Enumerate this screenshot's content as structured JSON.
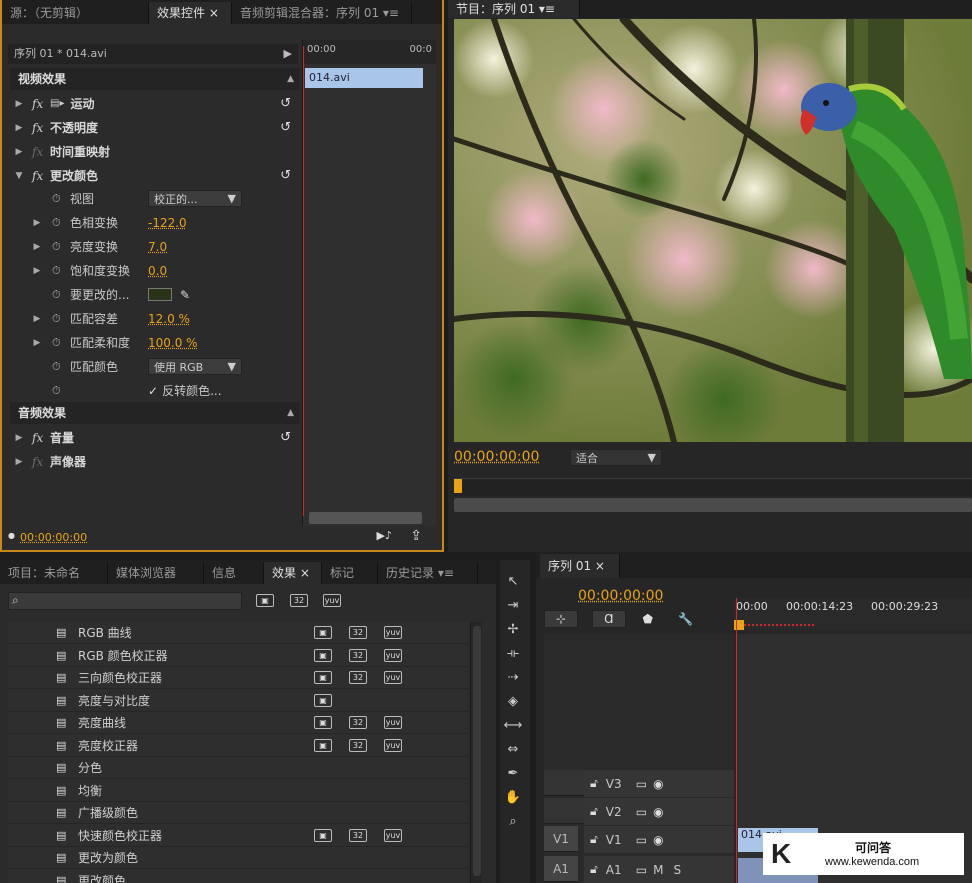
{
  "colors": {
    "accent": "#e8a317",
    "playhead": "#c62d2d",
    "clip": "#a9c6e8"
  },
  "effect_controls": {
    "tabs": [
      "源：（无剪辑）",
      "效果控件",
      "音频剪辑混合器：序列 01"
    ],
    "tab_close": "×",
    "header": "序列 01 * 014.avi",
    "time_ruler": [
      "00:00",
      "00:0"
    ],
    "clip_label": "014.avi",
    "video_section": "视频效果",
    "audio_section": "音频效果",
    "motion": "运动",
    "opacity": "不透明度",
    "time_remap": "时间重映射",
    "change_color": "更改颜色",
    "params": {
      "view_label": "视图",
      "view_value": "校正的...",
      "hue_label": "色相变换",
      "hue_value": "-122.0",
      "light_label": "亮度变换",
      "light_value": "7.0",
      "sat_label": "饱和度变换",
      "sat_value": "0.0",
      "color_label": "要更改的...",
      "tol_label": "匹配容差",
      "tol_value": "12.0 %",
      "soft_label": "匹配柔和度",
      "soft_value": "100.0 %",
      "match_label": "匹配颜色",
      "match_value": "使用 RGB",
      "invert_label": "反转颜色..."
    },
    "volume": "音量",
    "panner": "声像器",
    "timecode": "00:00:00:00"
  },
  "program": {
    "tab": "节目：序列 01",
    "timecode": "00:00:00:00",
    "fit": "适合"
  },
  "effects": {
    "tabs": [
      "项目：未命名",
      "媒体浏览器",
      "信息",
      "效果",
      "标记",
      "历史记录"
    ],
    "items": [
      "RGB 曲线",
      "RGB 颜色校正器",
      "三向颜色校正器",
      "亮度与对比度",
      "亮度曲线",
      "亮度校正器",
      "分色",
      "均衡",
      "广播级颜色",
      "快速颜色校正器",
      "更改为颜色",
      "更改颜色"
    ],
    "badges": [
      [
        1,
        1,
        1
      ],
      [
        1,
        1,
        1
      ],
      [
        1,
        1,
        1
      ],
      [
        1,
        0,
        0
      ],
      [
        1,
        1,
        1
      ],
      [
        1,
        1,
        1
      ],
      [
        0,
        0,
        0
      ],
      [
        0,
        0,
        0
      ],
      [
        0,
        0,
        0
      ],
      [
        1,
        1,
        1
      ],
      [
        0,
        0,
        0
      ],
      [
        0,
        0,
        0
      ]
    ]
  },
  "timeline": {
    "tab": "序列 01",
    "timecode": "00:00:00:00",
    "ruler": [
      "00:00",
      "00:00:14:23",
      "00:00:29:23"
    ],
    "tracks": [
      "V3",
      "V2",
      "V1",
      "A1"
    ],
    "src_v1": "V1",
    "src_a1": "A1",
    "clip": "014.avi",
    "m": "M",
    "s": "S"
  },
  "watermark": {
    "title": "可问答",
    "url": "www.kewenda.com"
  }
}
